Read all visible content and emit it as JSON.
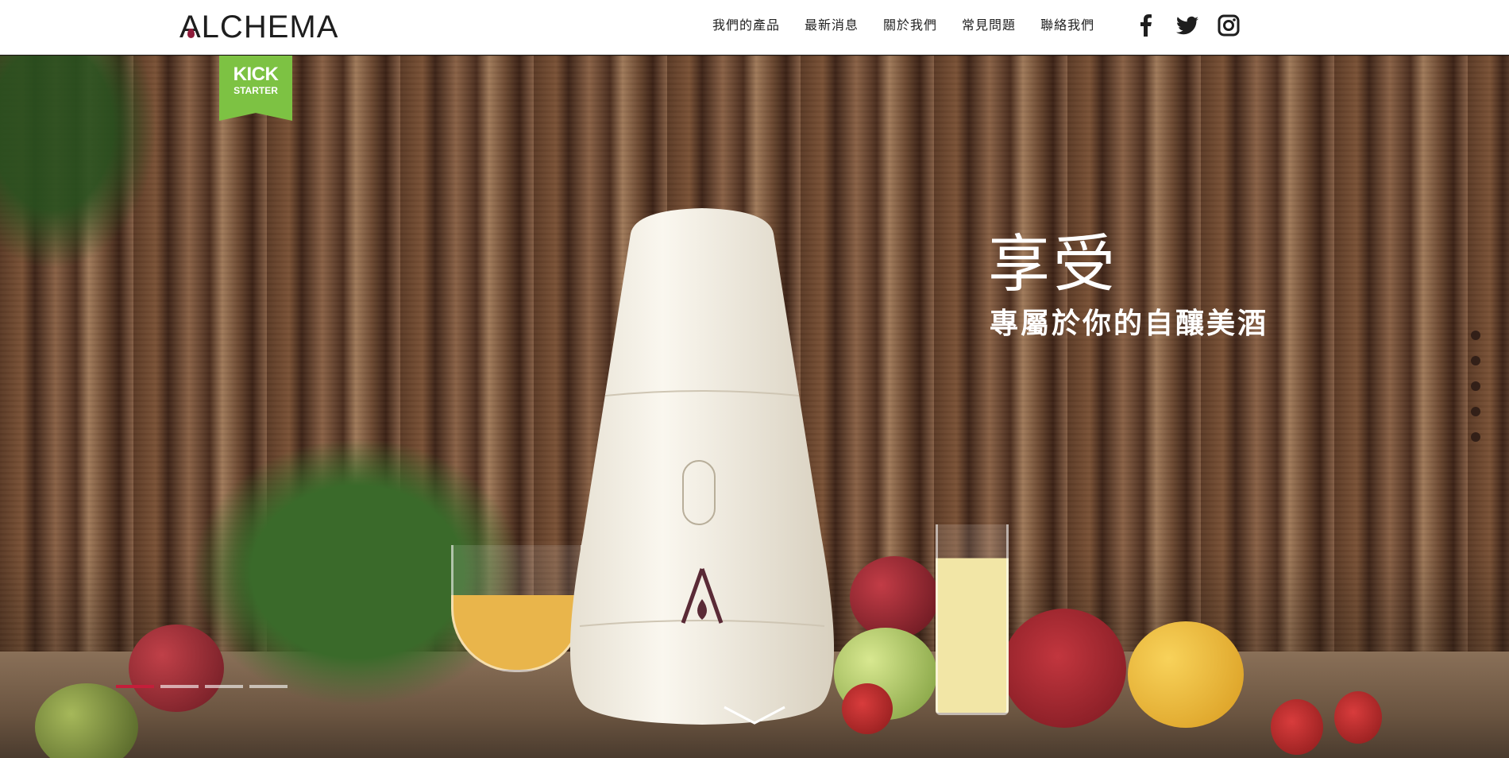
{
  "brand": {
    "logo_text": "ALCHEMA"
  },
  "nav": {
    "items": [
      "我們的產品",
      "最新消息",
      "關於我們",
      "常見問題",
      "聯絡我們"
    ]
  },
  "social": [
    "facebook-icon",
    "twitter-icon",
    "instagram-icon"
  ],
  "badge": {
    "line1": "KICK",
    "line2": "STARTER"
  },
  "hero": {
    "title": "享受",
    "subtitle": "專屬於你的自釀美酒"
  },
  "slider": {
    "slide_count": 5,
    "progress_count": 4,
    "active_index": 0
  },
  "colors": {
    "accent": "#c41e3a",
    "kickstarter": "#7dc243",
    "header_bg": "#ffffff",
    "text_dark": "#222222"
  }
}
